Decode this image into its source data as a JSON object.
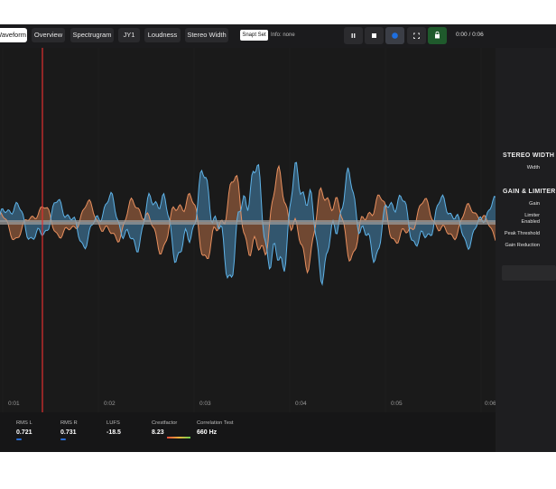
{
  "toolbar": {
    "tabs": [
      {
        "label": "Waveform",
        "active": true
      },
      {
        "label": "Overview",
        "active": false
      },
      {
        "label": "Spectrugram",
        "active": false
      },
      {
        "label": "JY1",
        "active": false
      },
      {
        "label": "Loudness",
        "active": false
      },
      {
        "label": "Stereo Width",
        "active": false
      }
    ],
    "snap_label": "Snapt Set",
    "info_text": "Info: none",
    "transport_icons": [
      "pause-icon",
      "stop-icon",
      "loop-dot-icon",
      "fullscreen-icon",
      "record-icon"
    ],
    "time_readout": "0:00 / 0:06"
  },
  "waveform": {
    "time_ticks": [
      "0:01",
      "0:02",
      "0:03",
      "0:04",
      "0:05",
      "0:06"
    ],
    "colors": {
      "left": "#4f9fd4",
      "right": "#d98050",
      "playhead": "#e03030",
      "center": "#9a9a9a"
    }
  },
  "right_panel": {
    "stereo_width": {
      "title": "STEREO WIDTH",
      "params": [
        "Width"
      ]
    },
    "gain_limiter": {
      "title": "GAIN & LIMITER",
      "params": [
        "Gain",
        "Limiter Enabled",
        "Peak Threshold",
        "Gain Reduction"
      ]
    }
  },
  "meters": [
    {
      "label": "RMS L",
      "value": "0.721",
      "bar": true
    },
    {
      "label": "RMS R",
      "value": "0.731",
      "bar": true
    },
    {
      "label": "LUFS",
      "value": "-18.5",
      "bar": false
    },
    {
      "label": "Crestfactor",
      "value": "8.23",
      "bar": false
    },
    {
      "label": "Correlation Test",
      "value": "660 Hz",
      "bar": false
    }
  ]
}
